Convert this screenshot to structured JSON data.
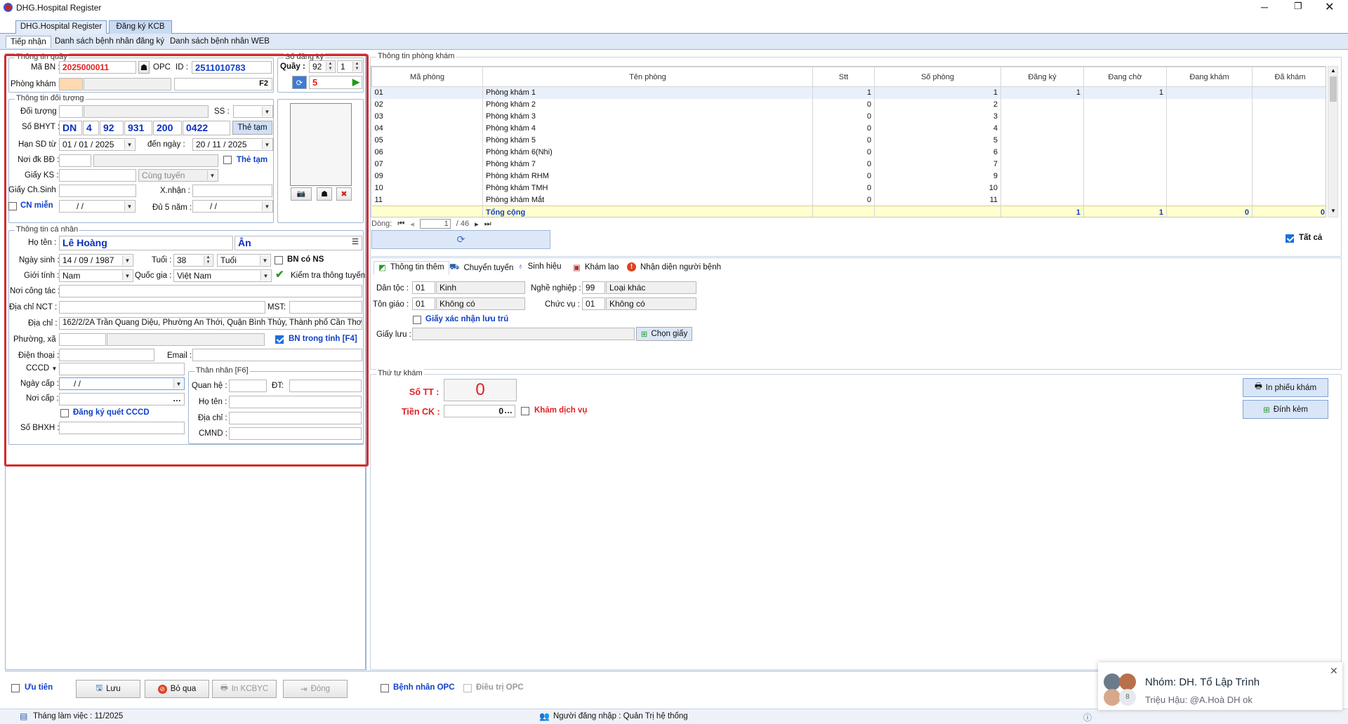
{
  "window": {
    "title": "DHG.Hospital Register"
  },
  "main_tabs": [
    "DHG.Hospital Register",
    "Đăng ký KCB"
  ],
  "sub_tabs": [
    "Tiếp nhận",
    "Danh sách bệnh nhân đăng ký",
    "Danh sách bệnh nhân WEB"
  ],
  "queue_info": {
    "title": "Thông tin quầy",
    "ma_bn_label": "Mã BN :",
    "ma_bn": "2025000011",
    "opc_label": "OPC",
    "id_label": "ID :",
    "id": "2511010783",
    "phong_kham_label": "Phòng khám :",
    "f2_label": "F2"
  },
  "register_no": {
    "title": "Số đăng ký",
    "quay_label": "Quầy :",
    "quay": "92",
    "quay2": "1",
    "number": "5"
  },
  "target_info": {
    "title": "Thông tin đối tượng",
    "doi_tuong_label": "Đối tượng :",
    "ss_label": "SS :",
    "so_bhyt_label": "Số BHYT :",
    "bhyt_parts": [
      "DN",
      "4",
      "92",
      "931",
      "200",
      "0422"
    ],
    "the_tam_button": "Thẻ tạm",
    "han_sd_label": "Hạn SD từ :",
    "han_sd_from": "01 / 01 / 2025",
    "den_ngay_label": "đến ngày :",
    "han_sd_to": "20 / 11 / 2025",
    "noi_dk_label": "Nơi đk BĐ :",
    "the_tam_check": "Thẻ tạm",
    "giay_ks_label": "Giấy KS :",
    "cung_tuyen": "Cùng tuyến",
    "giay_chsinh_label": "Giấy Ch.Sinh :",
    "xnhan_label": "X.nhận :",
    "cn_mien_label": "CN miễn",
    "date_empty": " /   /",
    "du5nam_label": "Đủ 5 năm :"
  },
  "personal": {
    "title": "Thông tin cá nhân",
    "ho_ten_label": "Họ tên :",
    "ho": "Lê Hoàng",
    "ten": "Ân",
    "ngay_sinh_label": "Ngày sinh :",
    "ngay_sinh": "14 / 09 / 1987",
    "tuoi_label": "Tuổi :",
    "tuoi": "38",
    "tuoi_unit": "Tuổi",
    "bn_co_ns": "BN có NS",
    "gioi_tinh_label": "Giới tính :",
    "gioi_tinh": "Nam",
    "quoc_gia_label": "Quốc gia :",
    "quoc_gia": "Việt Nam",
    "kiem_tra": "Kiểm tra thông tuyến",
    "noi_cong_tac_label": "Nơi công tác :",
    "dia_chi_nct_label": "Địa chỉ  NCT :",
    "mst_label": "MST:",
    "dia_chi_label": "Địa chỉ :",
    "dia_chi": "162/2/2A Trần Quang Diệu, Phường An Thới, Quận Bình Thủy, Thành phố Cần Thơ",
    "phuong_xa_label": "Phường, xã :",
    "bn_trong_tinh": "BN trong tỉnh [F4]",
    "dien_thoai_label": "Điện thoại :",
    "email_label": "Email :",
    "cccd_label": "CCCD",
    "ngay_cap_label": "Ngày cấp :",
    "noi_cap_label": "Nơi cấp :",
    "dang_ky_quet": "Đăng ký quét CCCD",
    "so_bhxh_label": "Số BHXH :",
    "than_nhan_title": "Thân nhân [F6]",
    "quan_he_label": "Quan hệ :",
    "dt_label": "ĐT:",
    "tn_ho_ten_label": "Họ tên :",
    "tn_dia_chi_label": "Địa chỉ :",
    "cmnd_label": "CMND :"
  },
  "room_table": {
    "title": "Thông tin phòng khám",
    "columns": [
      "Mã phòng",
      "Tên phòng",
      "Stt",
      "Số phòng",
      "Đăng ký",
      "Đang chờ",
      "Đang khám",
      "Đã khám"
    ],
    "rows": [
      [
        "01",
        "Phòng khám 1",
        "1",
        "1",
        "1",
        "1",
        "",
        ""
      ],
      [
        "02",
        "Phòng khám 2",
        "0",
        "2",
        "",
        "",
        "",
        ""
      ],
      [
        "03",
        "Phòng khám 3",
        "0",
        "3",
        "",
        "",
        "",
        ""
      ],
      [
        "04",
        "Phòng khám 4",
        "0",
        "4",
        "",
        "",
        "",
        ""
      ],
      [
        "05",
        "Phòng khám 5",
        "0",
        "5",
        "",
        "",
        "",
        ""
      ],
      [
        "06",
        "Phòng khám 6(Nhi)",
        "0",
        "6",
        "",
        "",
        "",
        ""
      ],
      [
        "07",
        "Phòng khám 7",
        "0",
        "7",
        "",
        "",
        "",
        ""
      ],
      [
        "09",
        "Phòng khám RHM",
        "0",
        "9",
        "",
        "",
        "",
        ""
      ],
      [
        "10",
        "Phòng khám TMH",
        "0",
        "10",
        "",
        "",
        "",
        ""
      ],
      [
        "11",
        "Phòng khám Mắt",
        "0",
        "11",
        "",
        "",
        "",
        ""
      ]
    ],
    "total_label": "Tổng cộng",
    "totals": [
      "1",
      "1",
      "0",
      "0"
    ],
    "pager_label": "Dòng:",
    "page": "1",
    "page_total": "/   46",
    "tat_ca": "Tất cả"
  },
  "extra_tabs": [
    "Thông tin thêm",
    "Chuyển tuyến",
    "Sinh hiệu",
    "Khám lao",
    "Nhận diện người bệnh"
  ],
  "extra": {
    "dan_toc_label": "Dân tộc :",
    "dan_toc_code": "01",
    "dan_toc": "Kinh",
    "nghe_nghiep_label": "Nghề nghiệp :",
    "nghe_nghiep_code": "99",
    "nghe_nghiep": "Loại khác",
    "ton_giao_label": "Tôn giáo :",
    "ton_giao_code": "01",
    "ton_giao": "Không có",
    "chuc_vu_label": "Chức vụ :",
    "chuc_vu_code": "01",
    "chuc_vu": "Không có",
    "giay_xac_nhan": "Giấy xác nhận lưu trú",
    "giay_luu_label": "Giấy lưu :",
    "chon_giay": "Chọn giấy"
  },
  "order": {
    "title": "Thứ tự khám",
    "so_tt_label": "Số TT :",
    "so_tt": "0",
    "tien_ck_label": "Tiền CK :",
    "tien_ck": "0",
    "kham_dich_vu": "Khám dịch vụ",
    "in_phieu": "In phiếu khám",
    "dinh_kem": "Đính kèm"
  },
  "bottom": {
    "uu_tien": "Ưu tiên",
    "luu": "Lưu",
    "bo_qua": "Bỏ qua",
    "in_kcbyc": "In KCBYC",
    "dong": "Đóng",
    "bn_opc": "Bệnh nhân OPC",
    "dieu_tri_opc": "Điều trị OPC"
  },
  "status": {
    "thang": "Tháng làm việc : 11/2025",
    "nguoi": "Người đăng nhập : Quản Trị hệ thống"
  },
  "toast": {
    "title": "Nhóm: DH. Tổ Lập Trình",
    "body": "Triệu Hậu: @A.Hoà DH ok",
    "badge": "8"
  },
  "colors": {
    "highlight": "#d42a2a",
    "accent": "#1040c8",
    "total_bg": "#ffffd0"
  }
}
